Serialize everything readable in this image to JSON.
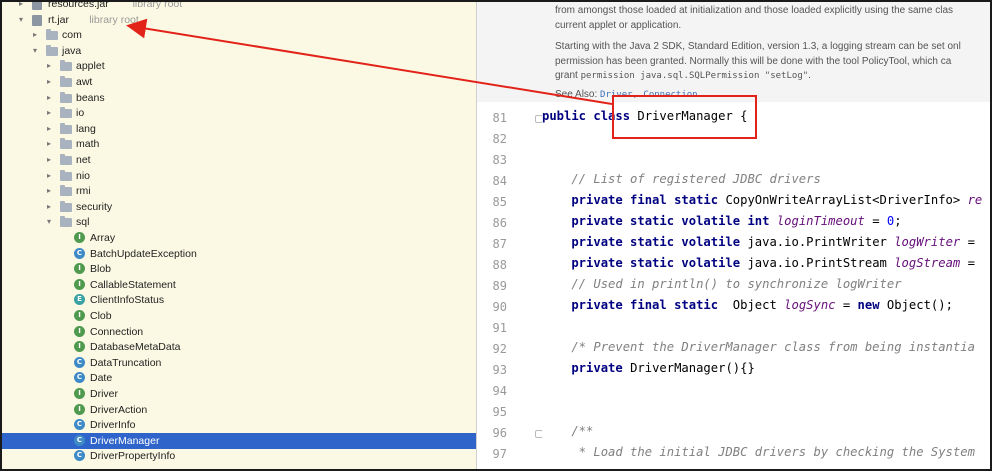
{
  "tree": {
    "rows": [
      {
        "label": "resources.jar",
        "hint": "library root",
        "kind": "jar",
        "depth": 1,
        "arrow": "▸"
      },
      {
        "label": "rt.jar",
        "hint": "library root",
        "kind": "jar",
        "depth": 1,
        "arrow": "▾"
      },
      {
        "label": "com",
        "kind": "folder",
        "depth": 2,
        "arrow": "▸"
      },
      {
        "label": "java",
        "kind": "folder",
        "depth": 2,
        "arrow": "▾"
      },
      {
        "label": "applet",
        "kind": "folder",
        "depth": 3,
        "arrow": "▸"
      },
      {
        "label": "awt",
        "kind": "folder",
        "depth": 3,
        "arrow": "▸"
      },
      {
        "label": "beans",
        "kind": "folder",
        "depth": 3,
        "arrow": "▸"
      },
      {
        "label": "io",
        "kind": "folder",
        "depth": 3,
        "arrow": "▸"
      },
      {
        "label": "lang",
        "kind": "folder",
        "depth": 3,
        "arrow": "▸"
      },
      {
        "label": "math",
        "kind": "folder",
        "depth": 3,
        "arrow": "▸"
      },
      {
        "label": "net",
        "kind": "folder",
        "depth": 3,
        "arrow": "▸"
      },
      {
        "label": "nio",
        "kind": "folder",
        "depth": 3,
        "arrow": "▸"
      },
      {
        "label": "rmi",
        "kind": "folder",
        "depth": 3,
        "arrow": "▸"
      },
      {
        "label": "security",
        "kind": "folder",
        "depth": 3,
        "arrow": "▸"
      },
      {
        "label": "sql",
        "kind": "folder",
        "depth": 3,
        "arrow": "▾"
      },
      {
        "label": "Array",
        "kind": "I",
        "depth": 4
      },
      {
        "label": "BatchUpdateException",
        "kind": "C",
        "depth": 4
      },
      {
        "label": "Blob",
        "kind": "I",
        "depth": 4
      },
      {
        "label": "CallableStatement",
        "kind": "I",
        "depth": 4
      },
      {
        "label": "ClientInfoStatus",
        "kind": "E",
        "depth": 4
      },
      {
        "label": "Clob",
        "kind": "I",
        "depth": 4
      },
      {
        "label": "Connection",
        "kind": "I",
        "depth": 4
      },
      {
        "label": "DatabaseMetaData",
        "kind": "I",
        "depth": 4
      },
      {
        "label": "DataTruncation",
        "kind": "C",
        "depth": 4
      },
      {
        "label": "Date",
        "kind": "C",
        "depth": 4
      },
      {
        "label": "Driver",
        "kind": "I",
        "depth": 4
      },
      {
        "label": "DriverAction",
        "kind": "I",
        "depth": 4
      },
      {
        "label": "DriverInfo",
        "kind": "C",
        "depth": 4
      },
      {
        "label": "DriverManager",
        "kind": "C",
        "depth": 4,
        "selected": true
      },
      {
        "label": "DriverPropertyInfo",
        "kind": "C",
        "depth": 4
      }
    ]
  },
  "doc": {
    "line1": "from amongst those loaded at initialization and those loaded explicitly using the same clas",
    "line2": "current applet or application.",
    "line3": "Starting with the Java 2 SDK, Standard Edition, version 1.3, a logging stream can be set onl",
    "line4": "permission has been granted. Normally this will be done with the tool PolicyTool, which ca",
    "line5_prefix": "grant ",
    "line5_code": "permission java.sql.SQLPermission \"setLog\"",
    "line5_suffix": ".",
    "see_also_label": "See Also:",
    "see_also_links": "Driver, Connection"
  },
  "editor": {
    "line_numbers": [
      "81",
      "82",
      "83",
      "84",
      "85",
      "86",
      "87",
      "88",
      "89",
      "90",
      "91",
      "92",
      "93",
      "94",
      "95",
      "96",
      "97"
    ]
  },
  "colors": {
    "tree_bg": "#fbf9e3",
    "selection": "#2f65ca",
    "keyword": "#000080",
    "comment": "#808080",
    "field": "#660e7a",
    "number": "#0000ff",
    "annotation": "#e2231a"
  }
}
